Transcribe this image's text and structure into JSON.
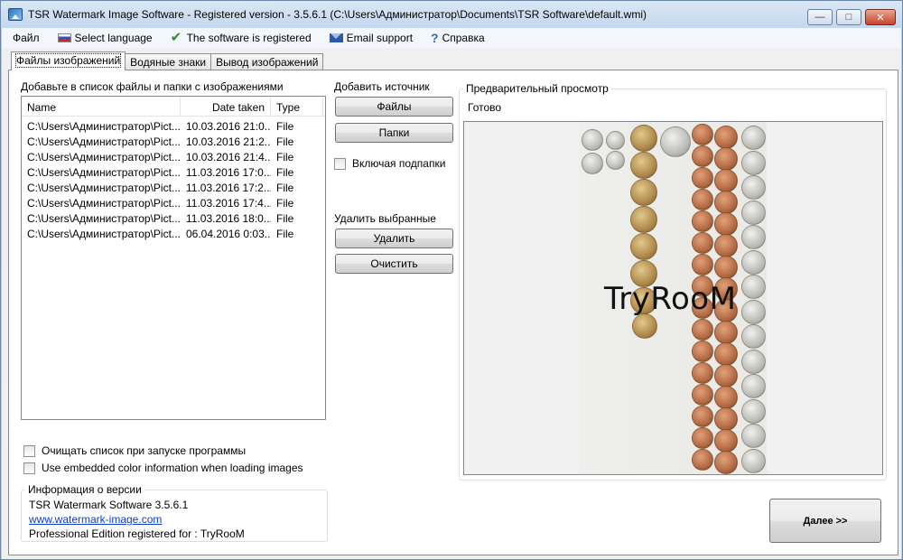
{
  "window": {
    "title": "TSR Watermark Image Software - Registered version - 3.5.6.1 (C:\\Users\\Администратор\\Documents\\TSR Software\\default.wmi)"
  },
  "menu": {
    "file": "Файл",
    "language": "Select language",
    "registered": "The software is registered",
    "email": "Email support",
    "help": "Справка"
  },
  "tabs": [
    "Файлы изображений",
    "Водяные знаки",
    "Вывод изображений"
  ],
  "files": {
    "label": "Добавьте в список файлы и папки с изображениями",
    "columns": [
      "Name",
      "Date taken",
      "Type"
    ],
    "rows": [
      {
        "name": "C:\\Users\\Администратор\\Pict...",
        "date": "10.03.2016 21:0...",
        "type": "File"
      },
      {
        "name": "C:\\Users\\Администратор\\Pict...",
        "date": "10.03.2016 21:2...",
        "type": "File"
      },
      {
        "name": "C:\\Users\\Администратор\\Pict...",
        "date": "10.03.2016 21:4...",
        "type": "File"
      },
      {
        "name": "C:\\Users\\Администратор\\Pict...",
        "date": "11.03.2016 17:0...",
        "type": "File"
      },
      {
        "name": "C:\\Users\\Администратор\\Pict...",
        "date": "11.03.2016 17:2...",
        "type": "File"
      },
      {
        "name": "C:\\Users\\Администратор\\Pict...",
        "date": "11.03.2016 17:4...",
        "type": "File"
      },
      {
        "name": "C:\\Users\\Администратор\\Pict...",
        "date": "11.03.2016 18:0...",
        "type": "File"
      },
      {
        "name": "C:\\Users\\Администратор\\Pict...",
        "date": "06.04.2016 0:03...",
        "type": "File"
      }
    ]
  },
  "options": {
    "clear_on_start": "Очищать список при запуске программы",
    "embedded_color": "Use embedded color information when loading images"
  },
  "add_source": {
    "label": "Добавить источник",
    "files_button": "Файлы",
    "folders_button": "Папки",
    "include_subfolders": "Включая подпапки"
  },
  "remove": {
    "label": "Удалить выбранные",
    "delete_button": "Удалить",
    "clear_button": "Очистить"
  },
  "preview": {
    "title": "Предварительный просмотр",
    "status": "Готово",
    "watermark": "TryRooM"
  },
  "version": {
    "title": "Информация о версии",
    "product": "TSR Watermark Software 3.5.6.1",
    "link": "www.watermark-image.com",
    "edition": "Professional Edition registered for : TryRooM"
  },
  "next_button": "Далее >>"
}
